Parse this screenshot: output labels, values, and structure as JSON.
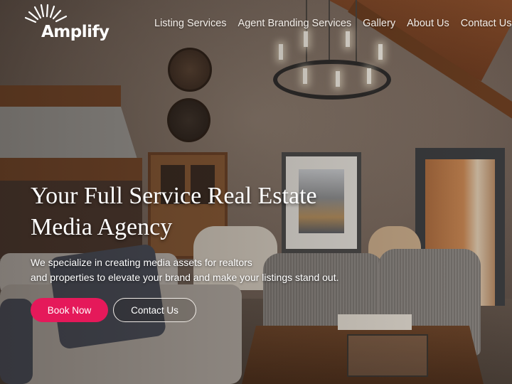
{
  "brand": {
    "name": "Amplify",
    "logo_icon": "sunburst-rays-icon"
  },
  "nav": {
    "items": [
      {
        "label": "Listing Services"
      },
      {
        "label": "Agent Branding Services"
      },
      {
        "label": "Gallery"
      },
      {
        "label": "About Us"
      },
      {
        "label": "Contact Us"
      }
    ]
  },
  "hero": {
    "headline_line1": "Your Full Service Real Estate",
    "headline_line2": "Media Agency",
    "subtitle_line1": "We specialize in creating media assets for realtors",
    "subtitle_line2": "and properties to elevate your brand and make your listings stand out.",
    "background_image": "rustic living room interior with chandelier, fireplace hood, framed heron print, striped armchairs",
    "primary_button": "Book Now",
    "secondary_button": "Contact Us"
  },
  "colors": {
    "accent": "#e5195a",
    "text": "#ffffff"
  }
}
